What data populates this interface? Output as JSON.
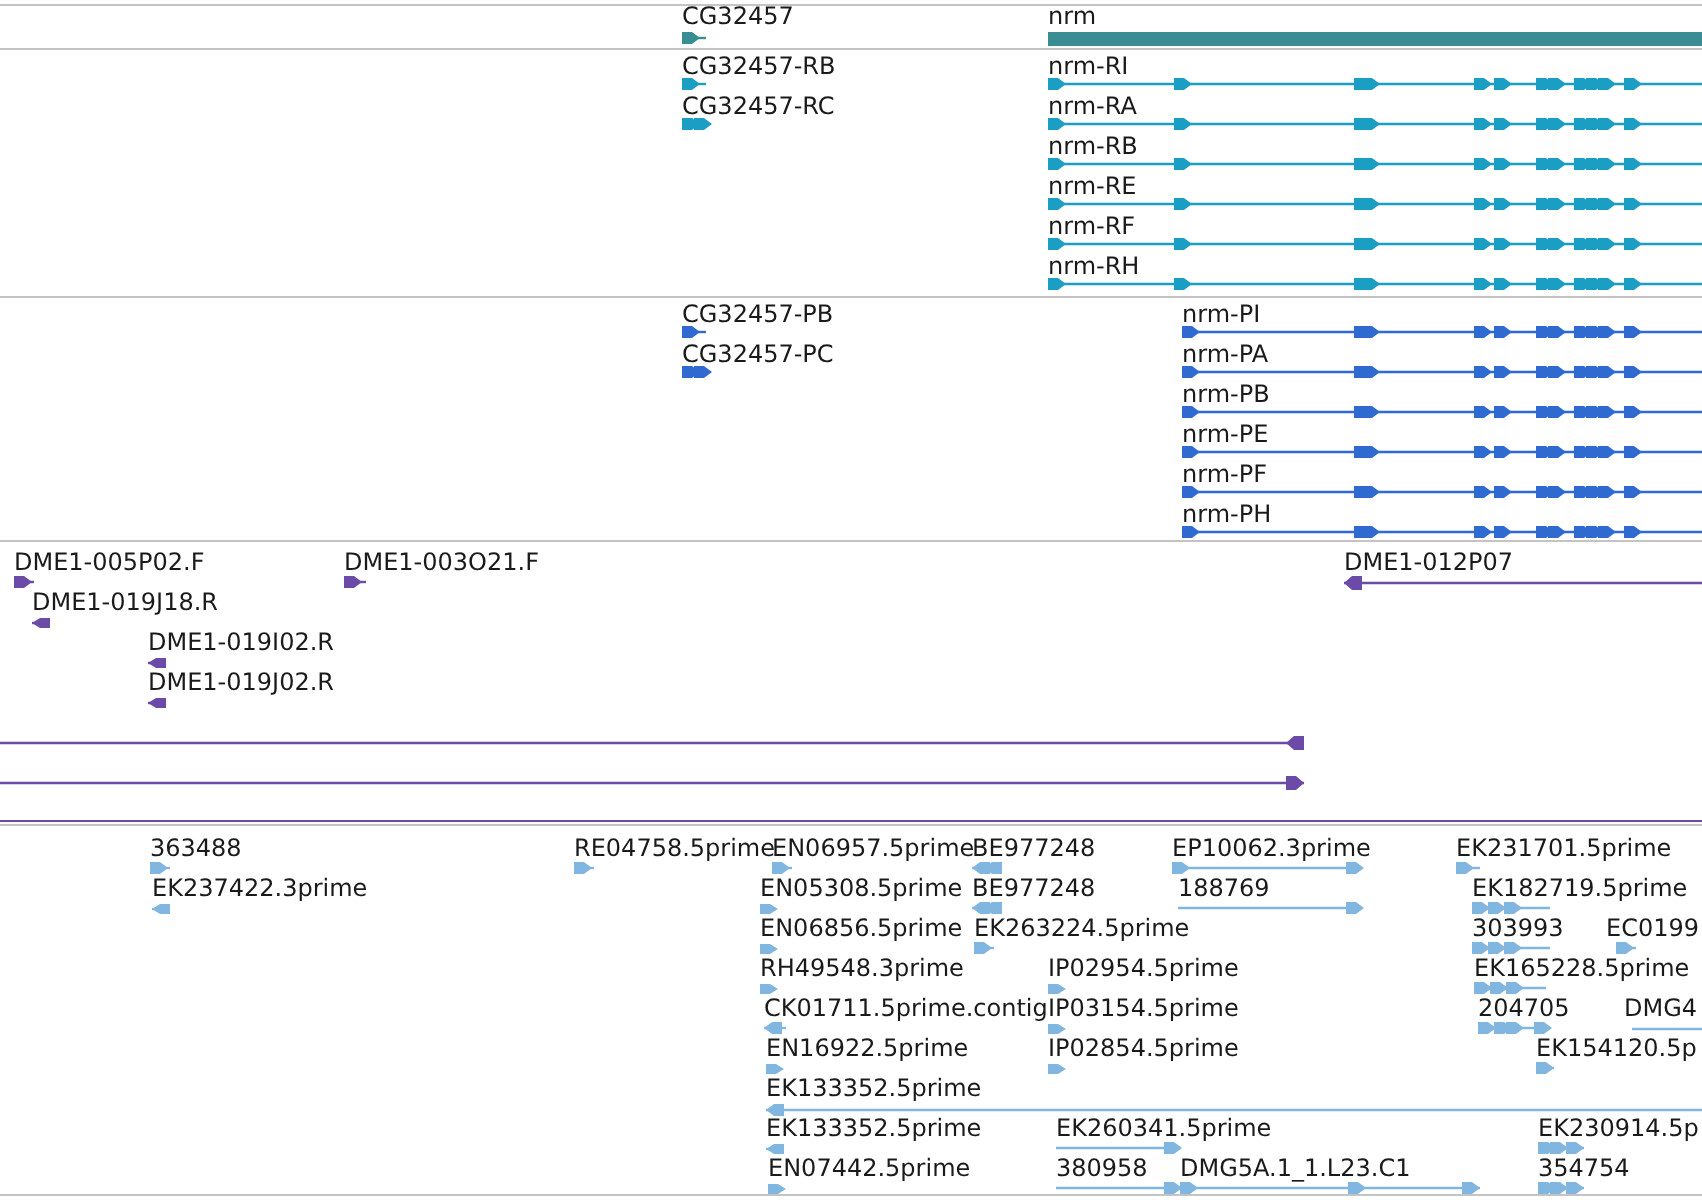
{
  "tracks": [
    {
      "color": "#3a8e93",
      "features": [
        {
          "label": "CG32457",
          "reverse": false
        },
        {
          "label": "nrm"
        }
      ]
    },
    {
      "color": "#1a9ec4",
      "features": [
        {
          "label": "CG32457-RB",
          "reverse": false
        },
        {
          "label": "CG32457-RC",
          "reverse": false
        },
        {
          "label": "nrm-RI",
          "reverse": false
        },
        {
          "label": "nrm-RA",
          "reverse": false
        },
        {
          "label": "nrm-RB",
          "reverse": false
        },
        {
          "label": "nrm-RE",
          "reverse": false
        },
        {
          "label": "nrm-RF",
          "reverse": false
        },
        {
          "label": "nrm-RH",
          "reverse": false
        }
      ]
    },
    {
      "color": "#2e6ad0",
      "features": [
        {
          "label": "CG32457-PB",
          "reverse": false
        },
        {
          "label": "CG32457-PC",
          "reverse": false
        },
        {
          "label": "nrm-PI",
          "reverse": false
        },
        {
          "label": "nrm-PA",
          "reverse": false
        },
        {
          "label": "nrm-PB",
          "reverse": false
        },
        {
          "label": "nrm-PE",
          "reverse": false
        },
        {
          "label": "nrm-PF",
          "reverse": false
        },
        {
          "label": "nrm-PH",
          "reverse": false
        }
      ]
    },
    {
      "color": "#6b4aa8",
      "features": [
        {
          "label": "DME1-005P02.F",
          "reverse": false
        },
        {
          "label": "DME1-003O21.F",
          "reverse": false
        },
        {
          "label": "DME1-012P07",
          "reverse": true
        },
        {
          "label": "DME1-019J18.R",
          "reverse": true
        },
        {
          "label": "DME1-019I02.R",
          "reverse": true
        },
        {
          "label": "DME1-019J02.R",
          "reverse": true
        },
        {
          "reverse": true
        },
        {
          "reverse": false
        }
      ]
    },
    {
      "color": "#80b6df",
      "features": [
        {
          "label": "363488",
          "reverse": false
        },
        {
          "label": "RE04758.5prime",
          "reverse": false
        },
        {
          "label": "EN06957.5prime",
          "reverse": false
        },
        {
          "label": "BE977248",
          "reverse": true
        },
        {
          "label": "EP10062.3prime",
          "reverse": false
        },
        {
          "label": "EK231701.5prime",
          "reverse": false
        },
        {
          "label": "EK237422.3prime",
          "reverse": true
        },
        {
          "label": "EN05308.5prime",
          "reverse": false
        },
        {
          "label": "BE977248",
          "reverse": true
        },
        {
          "label": "188769",
          "reverse": false
        },
        {
          "label": "EK182719.5prime",
          "reverse": false
        },
        {
          "label": "EN06856.5prime",
          "reverse": false
        },
        {
          "label": "EK263224.5prime",
          "reverse": false
        },
        {
          "label": "303993",
          "reverse": false
        },
        {
          "label": "EC0199",
          "reverse": false
        },
        {
          "label": "RH49548.3prime",
          "reverse": false
        },
        {
          "label": "IP02954.5prime",
          "reverse": false
        },
        {
          "label": "EK165228.5prime",
          "reverse": false
        },
        {
          "label": "CK01711.5prime.contig",
          "reverse": true
        },
        {
          "label": "IP03154.5prime",
          "reverse": false
        },
        {
          "label": "204705",
          "reverse": false
        },
        {
          "label": "DMG4"
        },
        {
          "label": "EN16922.5prime",
          "reverse": false
        },
        {
          "label": "IP02854.5prime",
          "reverse": false
        },
        {
          "label": "EK154120.5p",
          "reverse": false
        },
        {
          "label": "EK133352.5prime",
          "reverse": true
        },
        {
          "label": "EK133352.5prime",
          "reverse": true
        },
        {
          "label": "EK260341.5prime",
          "reverse": false
        },
        {
          "label": "EK230914.5p",
          "reverse": false
        },
        {
          "label": "EN07442.5prime",
          "reverse": false
        },
        {
          "label": "380958",
          "reverse": false
        },
        {
          "label": "DMG5A.1_1.L23.C1",
          "reverse": false
        },
        {
          "label": "354754",
          "reverse": false
        }
      ]
    }
  ]
}
